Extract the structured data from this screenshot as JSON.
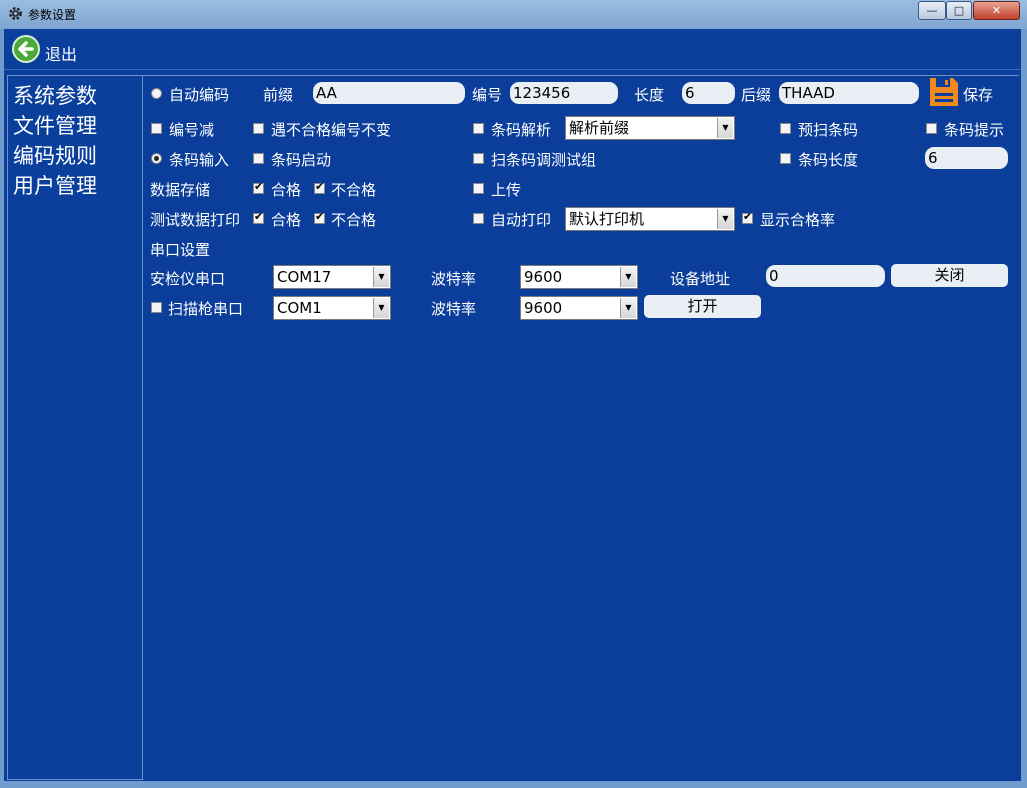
{
  "window": {
    "title": "参数设置",
    "controls": [
      "—",
      "□",
      "✕"
    ]
  },
  "topbar": {
    "exit_label": "退出"
  },
  "sidebar": {
    "items": [
      "系统参数",
      "文件管理",
      "编码规则",
      "用户管理"
    ]
  },
  "row1": {
    "auto_code_label": "自动编码",
    "prefix_label": "前缀",
    "prefix_value": "AA",
    "number_label": "编号",
    "number_value": "123456",
    "length_label": "长度",
    "length_value": "6",
    "suffix_label": "后缀",
    "suffix_value": "THAAD",
    "save_label": "保存"
  },
  "row2": {
    "num_decrease": "编号减",
    "keep_on_fail": "遇不合格编号不变",
    "barcode_parse": "条码解析",
    "parse_option": "解析前缀",
    "pre_scan": "预扫条码",
    "barcode_hint": "条码提示"
  },
  "row3": {
    "barcode_input": "条码输入",
    "barcode_start": "条码启动",
    "scan_test_group": "扫条码调测试组",
    "barcode_length": "条码长度",
    "barcode_length_value": "6"
  },
  "row4": {
    "data_storage": "数据存储",
    "pass": "合格",
    "fail": "不合格",
    "upload": "上传"
  },
  "row5": {
    "test_print": "测试数据打印",
    "pass": "合格",
    "fail": "不合格",
    "auto_print": "自动打印",
    "printer": "默认打印机",
    "show_pass_rate": "显示合格率"
  },
  "serial": {
    "section_title": "串口设置",
    "tester_port_label": "安检仪串口",
    "tester_port": "COM17",
    "baud_label": "波特率",
    "tester_baud": "9600",
    "device_addr_label": "设备地址",
    "device_addr": "0",
    "close_label": "关闭",
    "scanner_port_label": "扫描枪串口",
    "scanner_port": "COM1",
    "scanner_baud": "9600",
    "open_label": "打开"
  },
  "colors": {
    "background": "#0a3e9a",
    "field": "#eaeef5",
    "save_icon": "#f08a1c",
    "back_icon": "#4ba83a"
  }
}
